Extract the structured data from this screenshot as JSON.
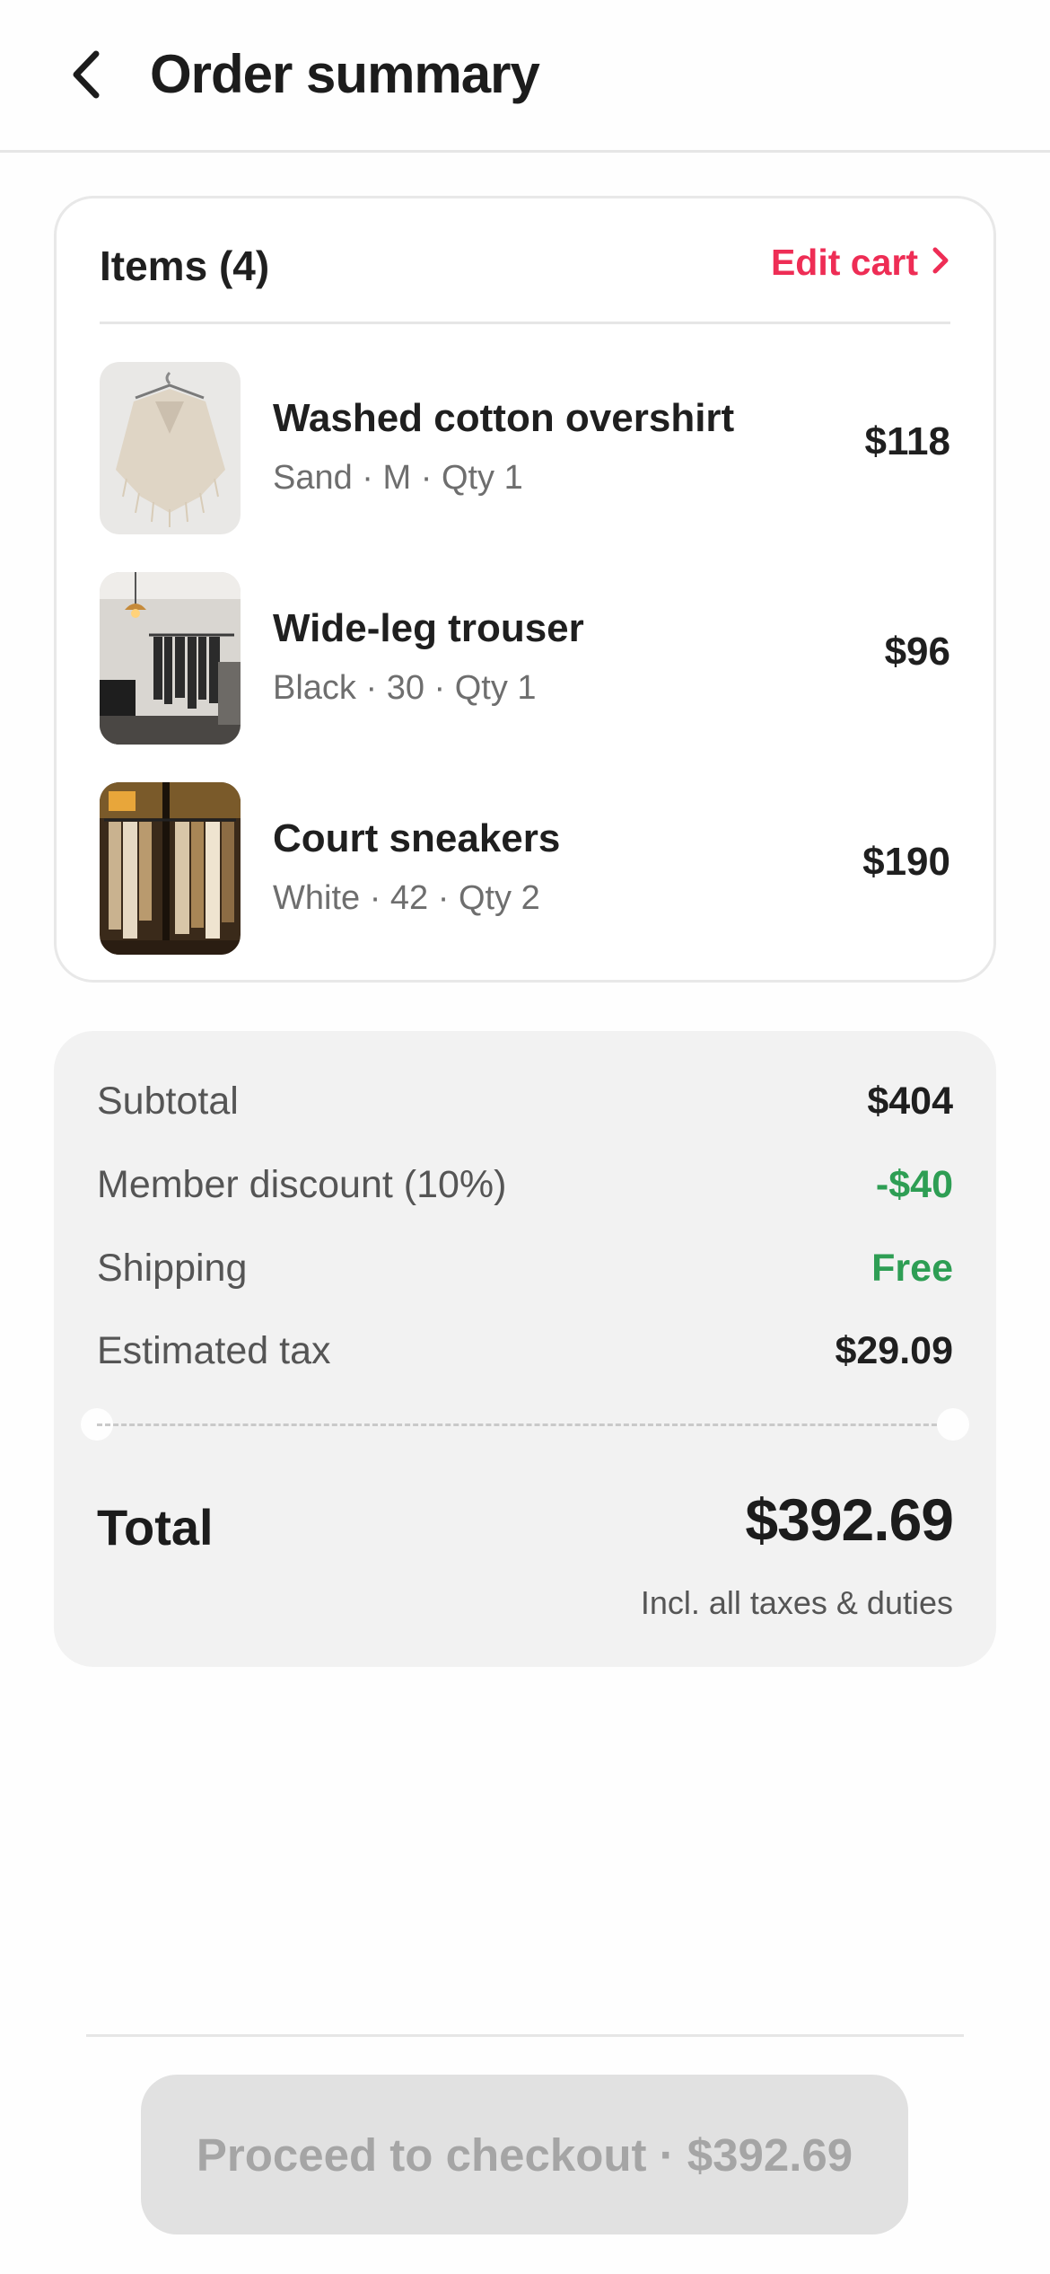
{
  "header": {
    "title": "Order summary"
  },
  "cart": {
    "title": "Items (4)",
    "edit_label": "Edit cart",
    "items": [
      {
        "name": "Washed cotton overshirt",
        "meta": "Sand · M  ·  Qty 1",
        "price": "$118",
        "image": "cream-knit-poncho-photo"
      },
      {
        "name": "Wide-leg trouser",
        "meta": "Black · 30  ·  Qty 1",
        "price": "$96",
        "image": "clothing-store-rack-photo"
      },
      {
        "name": "Court sneakers",
        "meta": "White · 42  ·  Qty 2",
        "price": "$190",
        "image": "shop-window-coats-photo"
      }
    ]
  },
  "summary": {
    "subtotal_label": "Subtotal",
    "subtotal": "$404",
    "discount_label": "Member discount (10%)",
    "discount": "-$40",
    "shipping_label": "Shipping",
    "shipping": "Free",
    "tax_label": "Estimated tax",
    "tax": "$29.09",
    "total_label": "Total",
    "total": "$392.69",
    "total_note": "Incl. all taxes & duties"
  },
  "checkout": {
    "label": "Proceed to checkout · $392.69"
  },
  "colors": {
    "accent": "#ee2d55",
    "positive": "#2e9e54",
    "button_disabled": "#e1e1e1"
  }
}
